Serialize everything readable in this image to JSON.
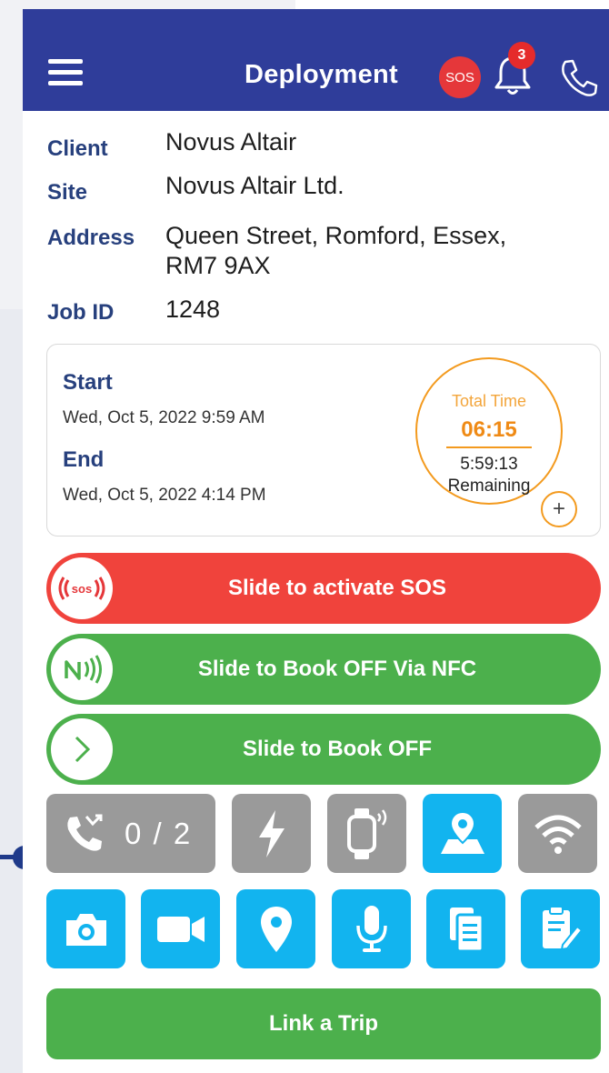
{
  "header": {
    "title": "Deployment",
    "sos_label": "SOS",
    "notification_count": "3"
  },
  "details": {
    "client": {
      "label": "Client",
      "value": "Novus Altair"
    },
    "site": {
      "label": "Site",
      "value": "Novus Altair Ltd."
    },
    "address": {
      "label": "Address",
      "value_line1": "Queen Street, Romford, Essex,",
      "value_line2": "RM7 9AX"
    },
    "job": {
      "label": "Job ID",
      "value": "1248"
    }
  },
  "schedule": {
    "start_label": "Start",
    "start_value": "Wed, Oct 5, 2022 9:59 AM",
    "end_label": "End",
    "end_value": "Wed, Oct 5, 2022 4:14 PM",
    "total_time_label": "Total Time",
    "total_time_value": "06:15",
    "remaining_value": "5:59:13",
    "remaining_label": "Remaining",
    "add_label": "+"
  },
  "sliders": {
    "sos": "Slide to activate SOS",
    "nfc": "Slide to Book OFF Via NFC",
    "book_off": "Slide to Book OFF"
  },
  "toolbar": {
    "call_counter": "0 / 2"
  },
  "icons": {
    "menu": "menu-icon",
    "bell": "bell-icon",
    "phone": "phone-icon",
    "missed_call": "missed-call-icon",
    "flash": "flash-icon",
    "smartwatch": "smartwatch-icon",
    "map": "map-pin-icon",
    "wifi": "wifi-icon",
    "camera": "camera-icon",
    "video": "video-icon",
    "location": "location-pin-icon",
    "mic": "microphone-icon",
    "documents": "documents-icon",
    "clipboard": "clipboard-edit-icon"
  },
  "colors": {
    "header": "#2f3d9a",
    "label": "#27407d",
    "sos_red": "#f0433c",
    "green": "#4cb04c",
    "tile_blue": "#12b4ef",
    "tile_gray": "#9a9a9a",
    "orange": "#f39a1e"
  },
  "link_trip_label": "Link a Trip"
}
